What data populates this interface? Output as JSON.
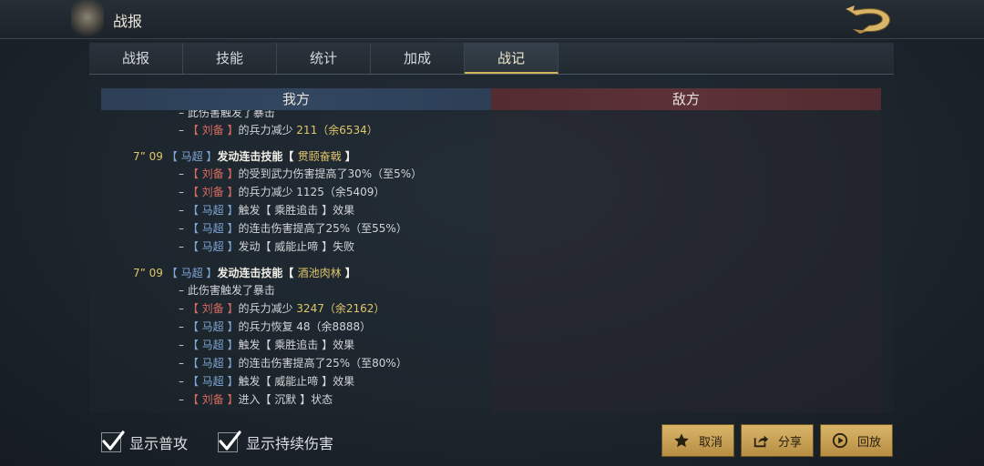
{
  "header": {
    "title": "战报"
  },
  "tabs": [
    {
      "label": "战报"
    },
    {
      "label": "技能"
    },
    {
      "label": "统计"
    },
    {
      "label": "加成"
    },
    {
      "label": "战记"
    }
  ],
  "active_tab_index": 4,
  "columns": {
    "ours": "我方",
    "enemy": "敌方"
  },
  "log_lines": [
    {
      "segs": [
        {
          "t": "– 此伤害触发了暴击",
          "c": "w"
        }
      ]
    },
    {
      "segs": [
        {
          "t": "– ",
          "c": "w"
        },
        {
          "t": "【 刘备 】",
          "c": "r"
        },
        {
          "t": "的兵力减少 ",
          "c": "w"
        },
        {
          "t": "211（余6534）",
          "c": "y"
        }
      ]
    },
    {
      "segs": [
        {
          "t": "7” 09 ",
          "c": "time"
        },
        {
          "t": "【 马超 】",
          "c": "b"
        },
        {
          "t": "发动连击技能【 ",
          "c": "head"
        },
        {
          "t": "贯颐奋戟",
          "c": "y"
        },
        {
          "t": " 】",
          "c": "head"
        }
      ]
    },
    {
      "segs": [
        {
          "t": "– ",
          "c": "w"
        },
        {
          "t": "【 刘备 】",
          "c": "r"
        },
        {
          "t": "的受到武力伤害提高了30%（至5%）",
          "c": "w"
        }
      ]
    },
    {
      "segs": [
        {
          "t": "– ",
          "c": "w"
        },
        {
          "t": "【 刘备 】",
          "c": "r"
        },
        {
          "t": "的兵力减少 1125（余5409）",
          "c": "w"
        }
      ]
    },
    {
      "segs": [
        {
          "t": "– ",
          "c": "w"
        },
        {
          "t": "【 马超 】",
          "c": "b"
        },
        {
          "t": "触发【 乘胜追击 】效果",
          "c": "w"
        }
      ]
    },
    {
      "segs": [
        {
          "t": "– ",
          "c": "w"
        },
        {
          "t": "【 马超 】",
          "c": "b"
        },
        {
          "t": "的连击伤害提高了25%（至55%）",
          "c": "w"
        }
      ]
    },
    {
      "segs": [
        {
          "t": "– ",
          "c": "w"
        },
        {
          "t": "【 马超 】",
          "c": "b"
        },
        {
          "t": "发动【 威能止啼 】失败",
          "c": "w"
        }
      ]
    },
    {
      "segs": [
        {
          "t": "7” 09 ",
          "c": "time"
        },
        {
          "t": "【 马超 】",
          "c": "b"
        },
        {
          "t": "发动连击技能【 ",
          "c": "head"
        },
        {
          "t": "酒池肉林",
          "c": "y"
        },
        {
          "t": " 】",
          "c": "head"
        }
      ]
    },
    {
      "segs": [
        {
          "t": "– 此伤害触发了暴击",
          "c": "w"
        }
      ]
    },
    {
      "segs": [
        {
          "t": "– ",
          "c": "w"
        },
        {
          "t": "【 刘备 】",
          "c": "r"
        },
        {
          "t": "的兵力减少 ",
          "c": "w"
        },
        {
          "t": "3247（余2162）",
          "c": "y"
        }
      ]
    },
    {
      "segs": [
        {
          "t": "– ",
          "c": "w"
        },
        {
          "t": "【 马超 】",
          "c": "b"
        },
        {
          "t": "的兵力恢复 48（余8888）",
          "c": "w"
        }
      ]
    },
    {
      "segs": [
        {
          "t": "– ",
          "c": "w"
        },
        {
          "t": "【 马超 】",
          "c": "b"
        },
        {
          "t": "触发【 乘胜追击 】效果",
          "c": "w"
        }
      ]
    },
    {
      "segs": [
        {
          "t": "– ",
          "c": "w"
        },
        {
          "t": "【 马超 】",
          "c": "b"
        },
        {
          "t": "的连击伤害提高了25%（至80%）",
          "c": "w"
        }
      ]
    },
    {
      "segs": [
        {
          "t": "– ",
          "c": "w"
        },
        {
          "t": "【 马超 】",
          "c": "b"
        },
        {
          "t": "触发【 威能止啼 】效果",
          "c": "w"
        }
      ]
    },
    {
      "segs": [
        {
          "t": "– ",
          "c": "w"
        },
        {
          "t": "【 刘备 】",
          "c": "r"
        },
        {
          "t": "进入【 沉默 】状态",
          "c": "w"
        }
      ]
    }
  ],
  "options": [
    {
      "label": "显示普攻",
      "checked": true
    },
    {
      "label": "显示持续伤害",
      "checked": true
    }
  ],
  "buttons": [
    {
      "label": "取消",
      "icon": "star-icon"
    },
    {
      "label": "分享",
      "icon": "share-icon"
    },
    {
      "label": "回放",
      "icon": "play-icon"
    }
  ],
  "colors": {
    "ally_name": "#7fa8d8",
    "enemy_name": "#d86b61",
    "highlight": "#e0c56a",
    "button_gold": "#d9b56a"
  }
}
